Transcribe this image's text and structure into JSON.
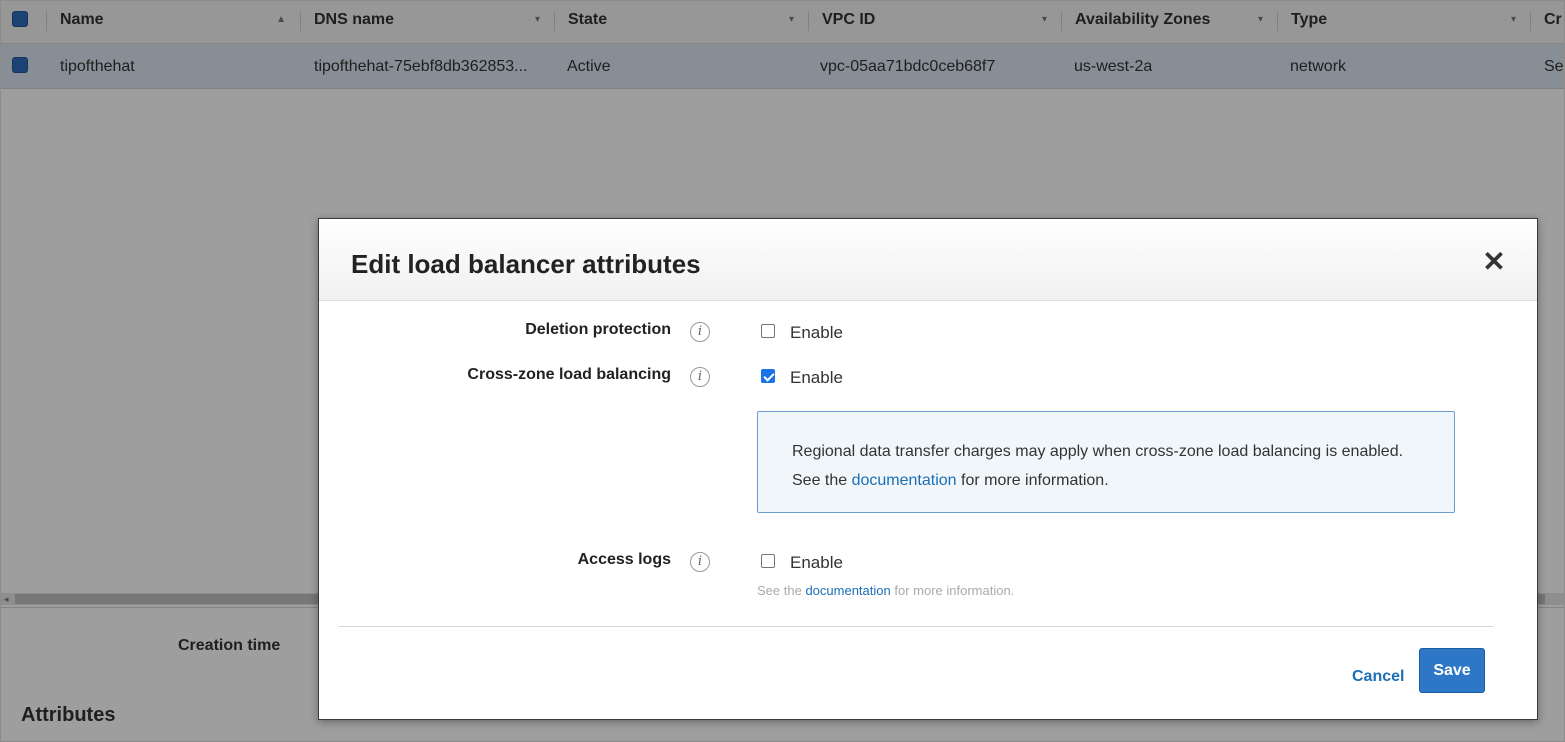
{
  "table": {
    "columns": [
      {
        "label": "Name",
        "sort": "▲"
      },
      {
        "label": "DNS name",
        "sort": "▾"
      },
      {
        "label": "State",
        "sort": "▾"
      },
      {
        "label": "VPC ID",
        "sort": "▾"
      },
      {
        "label": "Availability Zones",
        "sort": "▾"
      },
      {
        "label": "Type",
        "sort": "▾"
      },
      {
        "label": "Cr",
        "sort": ""
      }
    ],
    "row": {
      "name": "tipofthehat",
      "dns_name": "tipofthehat-75ebf8db362853...",
      "state": "Active",
      "vpc_id": "vpc-05aa71bdc0ceb68f7",
      "availability_zones": "us-west-2a",
      "type": "network",
      "created": "Se"
    }
  },
  "details": {
    "creation_time_label": "Creation time",
    "attributes_heading": "Attributes"
  },
  "modal": {
    "title": "Edit load balancer attributes",
    "close_symbol": "✕",
    "deletion_protection": {
      "label": "Deletion protection",
      "checkbox_label": "Enable",
      "checked": false
    },
    "cross_zone": {
      "label": "Cross-zone load balancing",
      "checkbox_label": "Enable",
      "checked": true
    },
    "info_box": {
      "text_before": "Regional data transfer charges may apply when cross-zone load balancing is enabled. See the",
      "link": "documentation",
      "text_after": "for more information."
    },
    "access_logs": {
      "label": "Access logs",
      "checkbox_label": "Enable",
      "checked": false,
      "note_before": "See the",
      "note_link": "documentation",
      "note_after": "for more information."
    },
    "info_icon_symbol": "i",
    "cancel_label": "Cancel",
    "save_label": "Save"
  },
  "colors": {
    "primary": "#2d77c6",
    "link": "#1c6fb5",
    "selected_row": "#dbe6f2",
    "checkbox_checked": "#1a73e8"
  }
}
